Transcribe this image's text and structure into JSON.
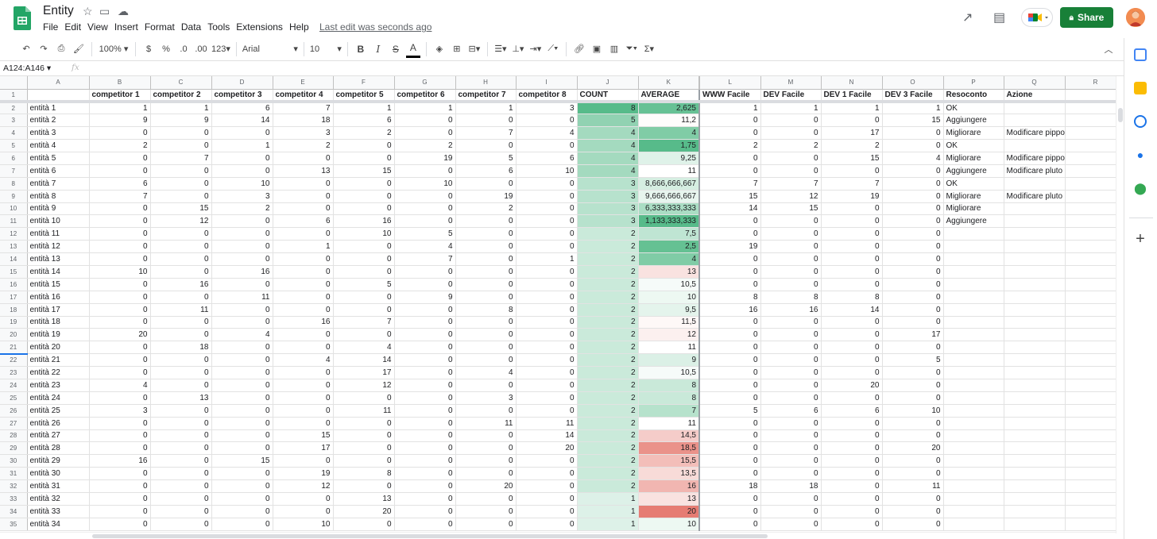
{
  "title": "Entity",
  "menus": [
    "File",
    "Edit",
    "View",
    "Insert",
    "Format",
    "Data",
    "Tools",
    "Extensions",
    "Help"
  ],
  "last_edit": "Last edit was seconds ago",
  "share_label": "Share",
  "toolbar": {
    "zoom": "100%",
    "currency": "$",
    "percent": "%",
    "dec_less": ".0",
    "dec_more": ".00",
    "format": "123",
    "font": "Arial",
    "font_size": "10"
  },
  "name_box": "A124:A146",
  "fx": "fx",
  "colors": {
    "share": "#188038",
    "green_dark": "#57bb8a",
    "red_dark": "#e67c73"
  },
  "columns": [
    "A",
    "B",
    "C",
    "D",
    "E",
    "F",
    "G",
    "H",
    "I",
    "J",
    "K",
    "L",
    "M",
    "N",
    "O",
    "P",
    "Q",
    "R"
  ],
  "headers": [
    "",
    "competitor 1",
    "competitor 2",
    "competitor 3",
    "competitor 4",
    "competitor 5",
    "competitor 6",
    "competitor 7",
    "competitor 8",
    "COUNT",
    "AVERAGE",
    "WWW Facile",
    "DEV Facile",
    "DEV 1 Facile",
    "DEV 3 Facile",
    "Resoconto",
    "Azione",
    ""
  ],
  "rows": [
    {
      "a": "entità 1",
      "c": [
        1,
        1,
        6,
        7,
        1,
        1,
        1,
        3
      ],
      "count": 8,
      "avg": "2,625",
      "l": [
        1,
        1,
        1,
        1
      ],
      "p": "OK",
      "q": ""
    },
    {
      "a": "entità 2",
      "c": [
        9,
        9,
        14,
        18,
        6,
        0,
        0,
        0
      ],
      "count": 5,
      "avg": "11,2",
      "l": [
        0,
        0,
        0,
        15
      ],
      "p": "Aggiungere",
      "q": ""
    },
    {
      "a": "entità 3",
      "c": [
        0,
        0,
        0,
        3,
        2,
        0,
        7,
        4
      ],
      "count": 4,
      "avg": "4",
      "l": [
        0,
        0,
        17,
        0
      ],
      "p": "Migliorare",
      "q": "Modificare pippo"
    },
    {
      "a": "entità 4",
      "c": [
        2,
        0,
        1,
        2,
        0,
        2,
        0,
        0
      ],
      "count": 4,
      "avg": "1,75",
      "l": [
        2,
        2,
        2,
        0
      ],
      "p": "OK",
      "q": ""
    },
    {
      "a": "entità 5",
      "c": [
        0,
        7,
        0,
        0,
        0,
        19,
        5,
        6
      ],
      "count": 4,
      "avg": "9,25",
      "l": [
        0,
        0,
        15,
        4
      ],
      "p": "Migliorare",
      "q": "Modificare pippo"
    },
    {
      "a": "entità 6",
      "c": [
        0,
        0,
        0,
        13,
        15,
        0,
        6,
        10
      ],
      "count": 4,
      "avg": "11",
      "l": [
        0,
        0,
        0,
        0
      ],
      "p": "Aggiungere",
      "q": "Modificare pluto"
    },
    {
      "a": "entità 7",
      "c": [
        6,
        0,
        10,
        0,
        0,
        10,
        0,
        0
      ],
      "count": 3,
      "avg": "8,666,666,667",
      "l": [
        7,
        7,
        7,
        0
      ],
      "p": "OK",
      "q": ""
    },
    {
      "a": "entità 8",
      "c": [
        7,
        0,
        3,
        0,
        0,
        0,
        19,
        0
      ],
      "count": 3,
      "avg": "9,666,666,667",
      "l": [
        15,
        12,
        19,
        0
      ],
      "p": "Migliorare",
      "q": "Modificare pluto"
    },
    {
      "a": "entità 9",
      "c": [
        0,
        15,
        2,
        0,
        0,
        0,
        2,
        0
      ],
      "count": 3,
      "avg": "6,333,333,333",
      "l": [
        14,
        15,
        0,
        0
      ],
      "p": "Migliorare",
      "q": ""
    },
    {
      "a": "entità 10",
      "c": [
        0,
        12,
        0,
        6,
        16,
        0,
        0,
        0
      ],
      "count": 3,
      "avg": "1,133,333,333",
      "l": [
        0,
        0,
        0,
        0
      ],
      "p": "Aggiungere",
      "q": ""
    },
    {
      "a": "entità 11",
      "c": [
        0,
        0,
        0,
        0,
        10,
        5,
        0,
        0
      ],
      "count": 2,
      "avg": "7,5",
      "l": [
        0,
        0,
        0,
        0
      ],
      "p": "",
      "q": ""
    },
    {
      "a": "entità 12",
      "c": [
        0,
        0,
        0,
        1,
        0,
        4,
        0,
        0
      ],
      "count": 2,
      "avg": "2,5",
      "l": [
        19,
        0,
        0,
        0
      ],
      "p": "",
      "q": ""
    },
    {
      "a": "entità 13",
      "c": [
        0,
        0,
        0,
        0,
        0,
        7,
        0,
        1
      ],
      "count": 2,
      "avg": "4",
      "l": [
        0,
        0,
        0,
        0
      ],
      "p": "",
      "q": ""
    },
    {
      "a": "entità 14",
      "c": [
        10,
        0,
        16,
        0,
        0,
        0,
        0,
        0
      ],
      "count": 2,
      "avg": "13",
      "l": [
        0,
        0,
        0,
        0
      ],
      "p": "",
      "q": ""
    },
    {
      "a": "entità 15",
      "c": [
        0,
        16,
        0,
        0,
        5,
        0,
        0,
        0
      ],
      "count": 2,
      "avg": "10,5",
      "l": [
        0,
        0,
        0,
        0
      ],
      "p": "",
      "q": ""
    },
    {
      "a": "entità 16",
      "c": [
        0,
        0,
        11,
        0,
        0,
        9,
        0,
        0
      ],
      "count": 2,
      "avg": "10",
      "l": [
        8,
        8,
        8,
        0
      ],
      "p": "",
      "q": ""
    },
    {
      "a": "entità 17",
      "c": [
        0,
        11,
        0,
        0,
        0,
        0,
        8,
        0
      ],
      "count": 2,
      "avg": "9,5",
      "l": [
        16,
        16,
        14,
        0
      ],
      "p": "",
      "q": ""
    },
    {
      "a": "entità 18",
      "c": [
        0,
        0,
        0,
        16,
        7,
        0,
        0,
        0
      ],
      "count": 2,
      "avg": "11,5",
      "l": [
        0,
        0,
        0,
        0
      ],
      "p": "",
      "q": ""
    },
    {
      "a": "entità 19",
      "c": [
        20,
        0,
        4,
        0,
        0,
        0,
        0,
        0
      ],
      "count": 2,
      "avg": "12",
      "l": [
        0,
        0,
        0,
        17
      ],
      "p": "",
      "q": ""
    },
    {
      "a": "entità 20",
      "c": [
        0,
        18,
        0,
        0,
        4,
        0,
        0,
        0
      ],
      "count": 2,
      "avg": "11",
      "l": [
        0,
        0,
        0,
        0
      ],
      "p": "",
      "q": ""
    },
    {
      "a": "entità 21",
      "c": [
        0,
        0,
        0,
        4,
        14,
        0,
        0,
        0
      ],
      "count": 2,
      "avg": "9",
      "l": [
        0,
        0,
        0,
        5
      ],
      "p": "",
      "q": ""
    },
    {
      "a": "entità 22",
      "c": [
        0,
        0,
        0,
        0,
        17,
        0,
        4,
        0
      ],
      "count": 2,
      "avg": "10,5",
      "l": [
        0,
        0,
        0,
        0
      ],
      "p": "",
      "q": ""
    },
    {
      "a": "entità 23",
      "c": [
        4,
        0,
        0,
        0,
        12,
        0,
        0,
        0
      ],
      "count": 2,
      "avg": "8",
      "l": [
        0,
        0,
        20,
        0
      ],
      "p": "",
      "q": ""
    },
    {
      "a": "entità 24",
      "c": [
        0,
        13,
        0,
        0,
        0,
        0,
        3,
        0
      ],
      "count": 2,
      "avg": "8",
      "l": [
        0,
        0,
        0,
        0
      ],
      "p": "",
      "q": ""
    },
    {
      "a": "entità 25",
      "c": [
        3,
        0,
        0,
        0,
        11,
        0,
        0,
        0
      ],
      "count": 2,
      "avg": "7",
      "l": [
        5,
        6,
        6,
        10
      ],
      "p": "",
      "q": ""
    },
    {
      "a": "entità 26",
      "c": [
        0,
        0,
        0,
        0,
        0,
        0,
        11,
        11
      ],
      "count": 2,
      "avg": "11",
      "l": [
        0,
        0,
        0,
        0
      ],
      "p": "",
      "q": ""
    },
    {
      "a": "entità 27",
      "c": [
        0,
        0,
        0,
        15,
        0,
        0,
        0,
        14
      ],
      "count": 2,
      "avg": "14,5",
      "l": [
        0,
        0,
        0,
        0
      ],
      "p": "",
      "q": ""
    },
    {
      "a": "entità 28",
      "c": [
        0,
        0,
        0,
        17,
        0,
        0,
        0,
        20
      ],
      "count": 2,
      "avg": "18,5",
      "l": [
        0,
        0,
        0,
        20
      ],
      "p": "",
      "q": ""
    },
    {
      "a": "entità 29",
      "c": [
        16,
        0,
        15,
        0,
        0,
        0,
        0,
        0
      ],
      "count": 2,
      "avg": "15,5",
      "l": [
        0,
        0,
        0,
        0
      ],
      "p": "",
      "q": ""
    },
    {
      "a": "entità 30",
      "c": [
        0,
        0,
        0,
        19,
        8,
        0,
        0,
        0
      ],
      "count": 2,
      "avg": "13,5",
      "l": [
        0,
        0,
        0,
        0
      ],
      "p": "",
      "q": ""
    },
    {
      "a": "entità 31",
      "c": [
        0,
        0,
        0,
        12,
        0,
        0,
        20,
        0
      ],
      "count": 2,
      "avg": "16",
      "l": [
        18,
        18,
        0,
        11
      ],
      "p": "",
      "q": ""
    },
    {
      "a": "entità 32",
      "c": [
        0,
        0,
        0,
        0,
        13,
        0,
        0,
        0
      ],
      "count": 1,
      "avg": "13",
      "l": [
        0,
        0,
        0,
        0
      ],
      "p": "",
      "q": ""
    },
    {
      "a": "entità 33",
      "c": [
        0,
        0,
        0,
        0,
        20,
        0,
        0,
        0
      ],
      "count": 1,
      "avg": "20",
      "l": [
        0,
        0,
        0,
        0
      ],
      "p": "",
      "q": ""
    },
    {
      "a": "entità 34",
      "c": [
        0,
        0,
        0,
        10,
        0,
        0,
        0,
        0
      ],
      "count": 1,
      "avg": "10",
      "l": [
        0,
        0,
        0,
        0
      ],
      "p": "",
      "q": ""
    }
  ]
}
